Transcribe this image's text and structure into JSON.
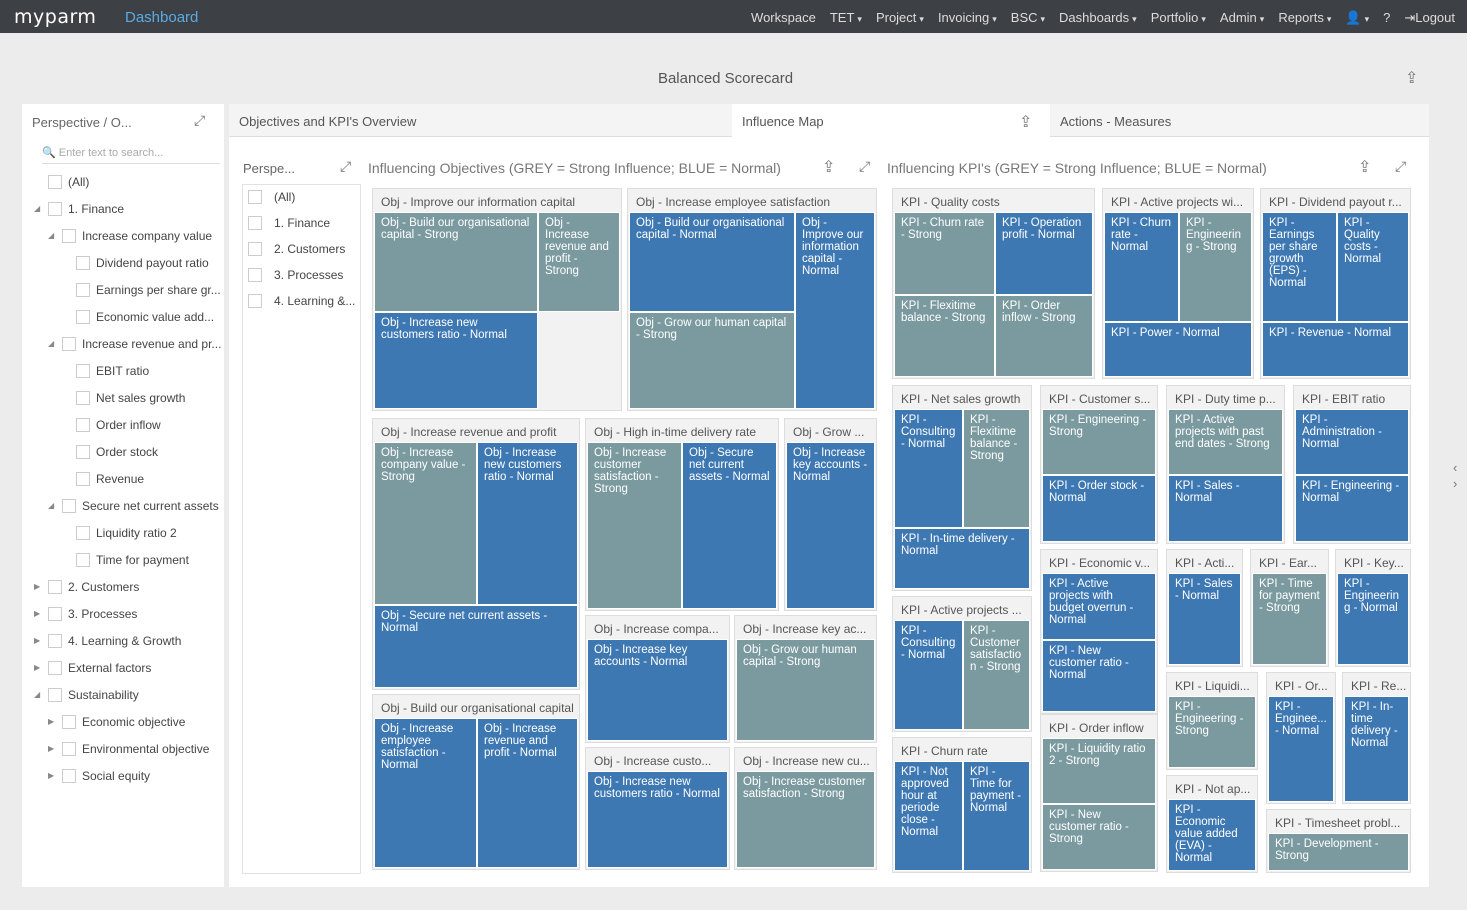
{
  "nav": {
    "logo": "myparm",
    "app": "Dashboard",
    "items": [
      "Workspace",
      "TET",
      "Project",
      "Invoicing",
      "BSC",
      "Dashboards",
      "Portfolio",
      "Admin",
      "Reports"
    ],
    "logout": "Logout"
  },
  "page_title": "Balanced Scorecard",
  "filter": {
    "title": "Perspective / O...",
    "search_placeholder": "Enter text to search...",
    "items": [
      {
        "label": "(All)",
        "lvl": 0,
        "arrow": ""
      },
      {
        "label": "1. Finance",
        "lvl": 0,
        "arrow": "down"
      },
      {
        "label": "Increase company value",
        "lvl": 1,
        "arrow": "down"
      },
      {
        "label": "Dividend payout ratio",
        "lvl": 2,
        "arrow": ""
      },
      {
        "label": "Earnings per share gr...",
        "lvl": 2,
        "arrow": ""
      },
      {
        "label": "Economic value add...",
        "lvl": 2,
        "arrow": ""
      },
      {
        "label": "Increase revenue and pr...",
        "lvl": 1,
        "arrow": "down"
      },
      {
        "label": "EBIT ratio",
        "lvl": 2,
        "arrow": ""
      },
      {
        "label": "Net sales growth",
        "lvl": 2,
        "arrow": ""
      },
      {
        "label": "Order inflow",
        "lvl": 2,
        "arrow": ""
      },
      {
        "label": "Order stock",
        "lvl": 2,
        "arrow": ""
      },
      {
        "label": "Revenue",
        "lvl": 2,
        "arrow": ""
      },
      {
        "label": "Secure net current assets",
        "lvl": 1,
        "arrow": "down"
      },
      {
        "label": "Liquidity ratio 2",
        "lvl": 2,
        "arrow": ""
      },
      {
        "label": "Time for payment",
        "lvl": 2,
        "arrow": ""
      },
      {
        "label": "2. Customers",
        "lvl": 0,
        "arrow": "right"
      },
      {
        "label": "3. Processes",
        "lvl": 0,
        "arrow": "right"
      },
      {
        "label": "4. Learning & Growth",
        "lvl": 0,
        "arrow": "right"
      },
      {
        "label": "External factors",
        "lvl": 0,
        "arrow": "right"
      },
      {
        "label": "Sustainability",
        "lvl": 0,
        "arrow": "down"
      },
      {
        "label": "Economic objective",
        "lvl": 1,
        "arrow": "right"
      },
      {
        "label": "Environmental objective",
        "lvl": 1,
        "arrow": "right"
      },
      {
        "label": "Social equity",
        "lvl": 1,
        "arrow": "right"
      }
    ]
  },
  "tabs": [
    "Objectives and KPI's Overview",
    "Influence Map",
    "Actions - Measures"
  ],
  "persp_filter": {
    "title": "Perspe...",
    "items": [
      "(All)",
      "1. Finance",
      "2. Customers",
      "3. Processes",
      "4. Learning &..."
    ]
  },
  "obj_title": "Influencing Objectives (GREY = Strong Influence; BLUE = Normal)",
  "kpi_title": "Influencing KPI's (GREY = Strong Influence; BLUE = Normal)",
  "obj_sections": [
    {
      "h": "Obj - Improve our information capital",
      "tiles": [
        "Obj - Build our organisational capital - Strong",
        "Obj - Increase revenue and profit - Strong",
        "Obj - Increase new customers ratio - Normal"
      ]
    },
    {
      "h": "Obj - Increase employee satisfaction",
      "tiles": [
        "Obj - Build our organisational capital - Normal",
        "Obj - Improve our information capital - Normal",
        "Obj - Grow our human capital - Strong"
      ]
    },
    {
      "h": "Obj - Increase revenue and profit",
      "tiles": [
        "Obj - Increase company value - Strong",
        "Obj - Increase new customers ratio - Normal",
        "Obj - Secure net current assets - Normal"
      ]
    },
    {
      "h": "Obj - High in-time delivery rate",
      "tiles": [
        "Obj - Increase customer satisfaction - Strong",
        "Obj - Secure net current assets - Normal"
      ]
    },
    {
      "h": "Obj - Grow ...",
      "tiles": [
        "Obj - Increase key accounts - Normal"
      ]
    },
    {
      "h": "Obj - Increase compa...",
      "tiles": [
        "Obj - Increase key accounts - Normal"
      ]
    },
    {
      "h": "Obj - Increase key ac...",
      "tiles": [
        "Obj - Grow our human capital - Strong"
      ]
    },
    {
      "h": "Obj - Build our organisational capital",
      "tiles": [
        "Obj - Increase employee satisfaction - Normal",
        "Obj - Increase revenue and profit - Normal"
      ]
    },
    {
      "h": "Obj - Increase custo...",
      "tiles": [
        "Obj - Increase new customers ratio - Normal"
      ]
    },
    {
      "h": "Obj - Increase new cu...",
      "tiles": [
        "Obj - Increase customer satisfaction - Strong"
      ]
    }
  ],
  "kpi_sections": [
    {
      "h": "KPI - Quality costs",
      "tiles": [
        "KPI - Churn rate - Strong",
        "KPI - Operation profit - Normal",
        "KPI - Flexitime balance - Strong",
        "KPI - Order inflow - Strong"
      ]
    },
    {
      "h": "KPI - Active projects wi...",
      "tiles": [
        "KPI - Churn rate - Normal",
        "KPI - Engineering - Strong",
        "KPI - Power - Normal"
      ]
    },
    {
      "h": "KPI - Dividend payout r...",
      "tiles": [
        "KPI - Earnings per share growth (EPS) - Normal",
        "KPI - Quality costs - Normal",
        "KPI - Revenue - Normal"
      ]
    },
    {
      "h": "KPI - Net sales growth",
      "tiles": [
        "KPI - Consulting - Normal",
        "KPI - Flexitime balance - Strong",
        "KPI - In-time delivery - Normal"
      ]
    },
    {
      "h": "KPI - Customer s...",
      "tiles": [
        "KPI - Engineering - Strong",
        "KPI - Order stock - Normal"
      ]
    },
    {
      "h": "KPI - Duty time p...",
      "tiles": [
        "KPI - Active projects with past end dates - Strong",
        "KPI - Sales - Normal"
      ]
    },
    {
      "h": "KPI - EBIT ratio",
      "tiles": [
        "KPI - Administration - Normal",
        "KPI - Engineering - Normal"
      ]
    },
    {
      "h": "KPI - Economic v...",
      "tiles": [
        "KPI - Active projects with budget overrun - Normal",
        "KPI - New customer ratio - Normal"
      ]
    },
    {
      "h": "KPI - Acti...",
      "tiles": [
        "KPI - Sales - Normal"
      ]
    },
    {
      "h": "KPI - Ear...",
      "tiles": [
        "KPI - Time for payment - Strong"
      ]
    },
    {
      "h": "KPI - Key...",
      "tiles": [
        "KPI - Engineering - Normal"
      ]
    },
    {
      "h": "KPI - Active projects ...",
      "tiles": [
        "KPI - Consulting - Normal",
        "KPI - Customer satisfaction - Strong"
      ]
    },
    {
      "h": "KPI - Liquidi...",
      "tiles": [
        "KPI - Engineering - Strong"
      ]
    },
    {
      "h": "KPI - Or...",
      "tiles": [
        "KPI - Enginee... - Normal"
      ]
    },
    {
      "h": "KPI - Re...",
      "tiles": [
        "KPI - In-time delivery - Normal"
      ]
    },
    {
      "h": "KPI - Order inflow",
      "tiles": [
        "KPI - Liquidity ratio 2 - Strong",
        "KPI - New customer ratio - Strong"
      ]
    },
    {
      "h": "KPI - Churn rate",
      "tiles": [
        "KPI - Not approved hour at periode close - Normal",
        "KPI - Time for payment - Normal"
      ]
    },
    {
      "h": "KPI - Not ap...",
      "tiles": [
        "KPI - Economic value added (EVA) - Normal"
      ]
    },
    {
      "h": "KPI - Timesheet probl...",
      "tiles": [
        "KPI - Development - Strong"
      ]
    }
  ],
  "colors": {
    "strong": "#7a9aa0",
    "normal": "#3e78b3",
    "nav": "#3d4044"
  }
}
